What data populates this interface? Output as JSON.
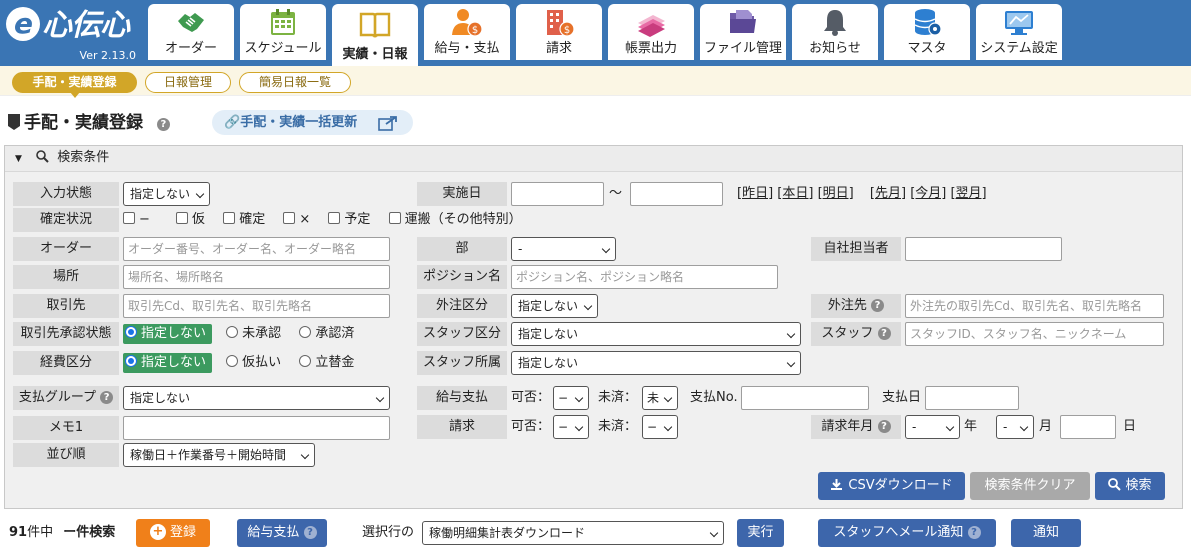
{
  "app": {
    "logo_text": "心伝心",
    "logo_e": "e",
    "version": "Ver 2.13.0"
  },
  "nav": {
    "tabs": [
      {
        "label": "オーダー",
        "icon": "handshake-icon"
      },
      {
        "label": "スケジュール",
        "icon": "calendar-icon"
      },
      {
        "label": "実績・日報",
        "icon": "open-book-icon",
        "active": true
      },
      {
        "label": "給与・支払",
        "icon": "person-coin-icon"
      },
      {
        "label": "請求",
        "icon": "building-coin-icon"
      },
      {
        "label": "帳票出力",
        "icon": "documents-icon"
      },
      {
        "label": "ファイル管理",
        "icon": "folder-icon"
      },
      {
        "label": "お知らせ",
        "icon": "bell-icon"
      },
      {
        "label": "マスタ",
        "icon": "database-gear-icon"
      },
      {
        "label": "システム設定",
        "icon": "monitor-settings-icon"
      }
    ]
  },
  "subnav": {
    "items": [
      "手配・実績登録",
      "日報管理",
      "簡易日報一覧"
    ]
  },
  "page": {
    "title": "手配・実績登録",
    "bulk_update_label": "手配・実績一括更新"
  },
  "search": {
    "header": "検索条件",
    "labels": {
      "input_status": "入力状態",
      "confirm_status": "確定状況",
      "order": "オーダー",
      "place": "場所",
      "client": "取引先",
      "client_approval": "取引先承認状態",
      "expense_type": "経費区分",
      "pay_group": "支払グループ",
      "memo1": "メモ1",
      "sort": "並び順",
      "date": "実施日",
      "dept": "部",
      "position": "ポジション名",
      "outsource_type": "外注区分",
      "staff_type": "スタッフ区分",
      "staff_affiliation": "スタッフ所属",
      "salary_pay": "給与支払",
      "billing": "請求",
      "own_rep": "自社担当者",
      "outsource": "外注先",
      "staff": "スタッフ",
      "billing_month": "請求年月"
    },
    "values": {
      "input_status": "指定しない",
      "dept": "-",
      "outsource_type": "指定しない",
      "staff_type": "指定しない",
      "staff_affiliation": "指定しない",
      "pay_group": "指定しない",
      "sort": "稼働日＋作業番号＋開始時間",
      "pay_possible": "−",
      "pay_unsettled": "未",
      "bill_possible": "−",
      "bill_unsettled": "−",
      "billing_year": "-",
      "billing_month": "-"
    },
    "placeholders": {
      "order": "オーダー番号、オーダー名、オーダー略名",
      "place": "場所名、場所略名",
      "client": "取引先Cd、取引先名、取引先略名",
      "position": "ポジション名、ポジション略名",
      "outsource": "外注先の取引先Cd、取引先名、取引先略名",
      "staff": "スタッフID、スタッフ名、ニックネーム"
    },
    "date_sep": "〜",
    "date_links": [
      "[昨日]",
      "[本日]",
      "[明日]",
      "[先月]",
      "[今月]",
      "[翌月]"
    ],
    "confirm_options": [
      "−",
      "仮",
      "確定",
      "×",
      "予定",
      "運搬（その他特別）"
    ],
    "approval_options": [
      "指定しない",
      "未承認",
      "承認済"
    ],
    "expense_options": [
      "指定しない",
      "仮払い",
      "立替金"
    ],
    "inline": {
      "possible": "可否：",
      "unsettled": "未済：",
      "pay_no": "支払No.",
      "pay_date": "支払日",
      "year": "年",
      "month": "月",
      "day": "日"
    },
    "buttons": {
      "csv": "CSVダウンロード",
      "clear": "検索条件クリア",
      "search": "検索"
    }
  },
  "footer": {
    "count": "91",
    "count_suffix": "件中",
    "searched": "ー件検索",
    "register": "登録",
    "salary_pay": "給与支払",
    "selected_rows_label": "選択行の",
    "action_select": "稼働明細集計表ダウンロード",
    "execute": "実行",
    "mail_notify": "スタッフへメール通知",
    "notify": "通知"
  },
  "colors": {
    "header_blue": "#3a75b4",
    "gold": "#d2a628",
    "button_blue": "#3d66ab",
    "register_orange": "#f0801a",
    "radio_green": "#3c9a5f"
  }
}
